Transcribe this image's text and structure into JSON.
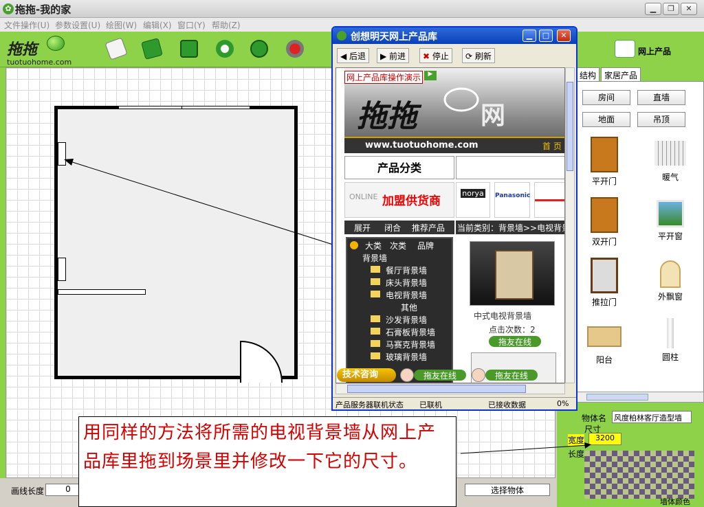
{
  "window": {
    "title": "拖拖-我的家"
  },
  "menu": [
    "文件操作(U)",
    "参数设置(U)",
    "绘图(W)",
    "编辑(X)",
    "窗口(Y)",
    "帮助(Z)"
  ],
  "logo": {
    "mark": "拖拖",
    "url": "tuotuohome.com"
  },
  "toolbar_icons": [
    "open-folder-icon",
    "book-icon",
    "save-icon",
    "refresh-icon",
    "sync-icon",
    "stop-icon"
  ],
  "right_panel": {
    "header": "网上产品",
    "tabs": [
      "结构",
      "家居产品"
    ],
    "buttons": [
      "房间",
      "直墙",
      "地面",
      "吊顶"
    ],
    "items": [
      "平开门",
      "暖气",
      "双开门",
      "平开窗",
      "推拉门",
      "外飘窗",
      "阳台",
      "圆柱"
    ],
    "props": {
      "name_label": "物体名",
      "name_value": "风度柏林客厅造型墙",
      "size_label": "尺寸",
      "width_label": "宽度",
      "width_value": "3200",
      "length_label": "长度",
      "color_label": "墙体颜色"
    }
  },
  "browser": {
    "title": "创想明天网上产品库",
    "tools": [
      "后退",
      "前进",
      "停止",
      "刷新"
    ],
    "demo_link": "网上产品库操作演示",
    "site_logo": "拖拖",
    "site_logo_suffix": "网",
    "site_url": "www.tuotuohome.com",
    "home": "首 页",
    "category_title": "产品分类",
    "banner_join": "加盟供货商",
    "brands": [
      "ONLINE",
      "norya",
      "Panasonic"
    ],
    "tree_tabs": [
      "展开",
      "闭合",
      "推荐产品"
    ],
    "current_category": "当前类别：背景墙>>电视背景墙",
    "tree_header": [
      "大类",
      "次类",
      "品牌"
    ],
    "tree": [
      "背景墙",
      "餐厅背景墙",
      "床头背景墙",
      "电视背景墙",
      "其他",
      "沙发背景墙",
      "石膏板背景墙",
      "马赛克背景墙",
      "玻璃背景墙"
    ],
    "product_name": "中式电视背景墙",
    "click_count": "点击次数：2",
    "online_label": "拖友在线",
    "consult": "技术咨询",
    "status": [
      "产品服务器联机状态",
      "已联机",
      "已接收数据",
      "0%"
    ]
  },
  "status_bar": {
    "line_length_label": "画线长度",
    "line_length_value": "0",
    "select_object": "选择物体"
  },
  "caption": "用同样的方法将所需的电视背景墙从网上产品库里拖到场景里并修改一下它的尺寸。"
}
